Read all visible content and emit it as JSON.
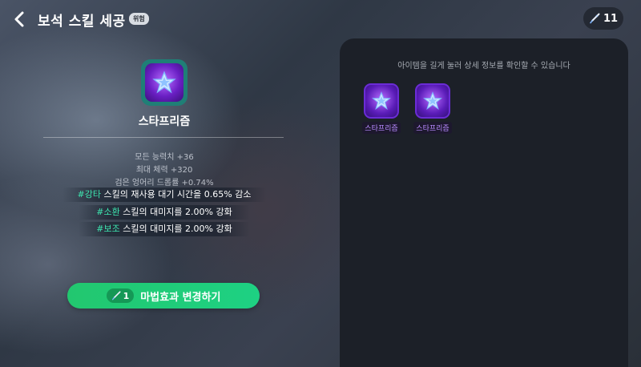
{
  "header": {
    "title": "보석 스킬 세공",
    "badge": "위험",
    "currency_count": "11"
  },
  "item": {
    "name": "스타프리즘",
    "stats": [
      "모든 능력치 +36",
      "최대 체력 +320",
      "검은 엉어리 드롭률 +0.74%"
    ],
    "effects": [
      {
        "tag": "#강타",
        "text": " 스킬의 재사용 대기 시간을 0.65% 감소"
      },
      {
        "tag": "#소환",
        "text": " 스킬의 대미지를 2.00% 강화"
      },
      {
        "tag": "#보조",
        "text": " 스킬의 대미지를 2.00% 강화"
      }
    ]
  },
  "action": {
    "cost": "1",
    "label": "마법효과 변경하기"
  },
  "inventory": {
    "hint": "아이템을 길게 눌러 상세 정보를 확인할 수 있습니다",
    "items": [
      {
        "label": "스타프리즘"
      },
      {
        "label": "스타프리즘"
      }
    ]
  },
  "colors": {
    "accent_green": "#22c76f",
    "tag_color": "#3ee6b0",
    "item_purple": "#6b2cd6"
  },
  "icons": [
    "back-arrow-icon",
    "quill-icon",
    "star-gem-icon"
  ]
}
